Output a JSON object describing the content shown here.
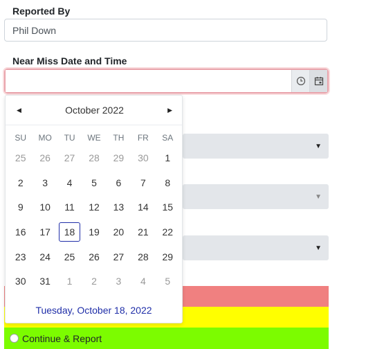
{
  "reported_by": {
    "label": "Reported By",
    "value": "Phil Down"
  },
  "near_miss": {
    "label": "Near Miss Date and Time",
    "value": ""
  },
  "datepicker": {
    "month_label": "October 2022",
    "prev_icon": "caret-left-icon",
    "next_icon": "caret-right-icon",
    "weekdays": [
      "SU",
      "MO",
      "TU",
      "WE",
      "TH",
      "FR",
      "SA"
    ],
    "weeks": [
      [
        {
          "d": "25",
          "m": true
        },
        {
          "d": "26",
          "m": true
        },
        {
          "d": "27",
          "m": true
        },
        {
          "d": "28",
          "m": true
        },
        {
          "d": "29",
          "m": true
        },
        {
          "d": "30",
          "m": true
        },
        {
          "d": "1"
        }
      ],
      [
        {
          "d": "2"
        },
        {
          "d": "3"
        },
        {
          "d": "4"
        },
        {
          "d": "5"
        },
        {
          "d": "6"
        },
        {
          "d": "7"
        },
        {
          "d": "8"
        }
      ],
      [
        {
          "d": "9"
        },
        {
          "d": "10"
        },
        {
          "d": "11"
        },
        {
          "d": "12"
        },
        {
          "d": "13"
        },
        {
          "d": "14"
        },
        {
          "d": "15"
        }
      ],
      [
        {
          "d": "16"
        },
        {
          "d": "17"
        },
        {
          "d": "18",
          "today": true
        },
        {
          "d": "19"
        },
        {
          "d": "20"
        },
        {
          "d": "21"
        },
        {
          "d": "22"
        }
      ],
      [
        {
          "d": "23"
        },
        {
          "d": "24"
        },
        {
          "d": "25"
        },
        {
          "d": "26"
        },
        {
          "d": "27"
        },
        {
          "d": "28"
        },
        {
          "d": "29"
        }
      ],
      [
        {
          "d": "30"
        },
        {
          "d": "31"
        },
        {
          "d": "1",
          "m": true
        },
        {
          "d": "2",
          "m": true
        },
        {
          "d": "3",
          "m": true
        },
        {
          "d": "4",
          "m": true
        },
        {
          "d": "5",
          "m": true
        }
      ]
    ],
    "footer": "Tuesday, October 18, 2022"
  },
  "selects": [
    {
      "arrow": "▼"
    },
    {
      "arrow": "▼"
    },
    {
      "arrow": "▼"
    }
  ],
  "actions": {
    "continue_label": "Continue & Report"
  },
  "colors": {
    "red_band": "#f08080",
    "yellow_band": "#ffff00",
    "green_band": "#7cfc00",
    "today_border": "#1f2ea8"
  }
}
